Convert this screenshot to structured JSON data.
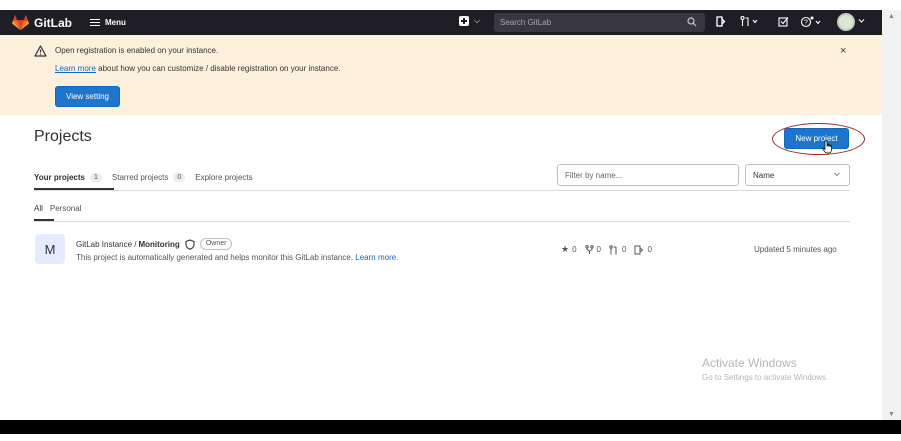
{
  "navbar": {
    "brand": "GitLab",
    "menu_label": "Menu",
    "search_placeholder": "Search GitLab"
  },
  "alert": {
    "title": "Open registration is enabled on your instance.",
    "link_text": "Learn more",
    "line_rest": " about how you can customize / disable registration on your instance.",
    "button_label": "View setting",
    "close_label": "×"
  },
  "page": {
    "title": "Projects",
    "new_project_label": "New project"
  },
  "tabs": [
    {
      "label": "Your projects",
      "count": "1"
    },
    {
      "label": "Starred projects",
      "count": "0"
    },
    {
      "label": "Explore projects",
      "count": ""
    }
  ],
  "filter": {
    "placeholder": "Filter by name...",
    "sort_value": "Name"
  },
  "subtabs": [
    {
      "label": "All"
    },
    {
      "label": "Personal"
    }
  ],
  "project": {
    "avatar_letter": "M",
    "namespace": "GitLab Instance /",
    "name": "Monitoring",
    "role": "Owner",
    "description": "This project is automatically generated and helps monitor this GitLab instance.",
    "learn_more": "Learn more.",
    "stars": "0",
    "forks": "0",
    "merge_requests": "0",
    "issues": "0",
    "updated": "Updated 5 minutes ago"
  },
  "watermark": {
    "title": "Activate Windows",
    "subtitle": "Go to Settings to activate Windows."
  },
  "colors": {
    "navbar_bg": "#1f1e24",
    "alert_bg": "#fdf1dd",
    "primary_button": "#1f75cb",
    "link": "#1068bf",
    "highlight_ellipse": "#a3262d"
  }
}
